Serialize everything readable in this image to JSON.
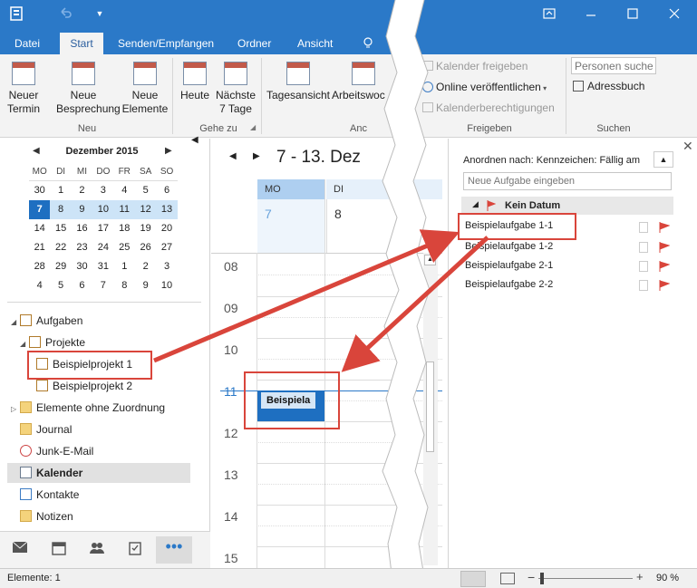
{
  "title_bar": {
    "colors": {
      "primary": "#2b79c8"
    }
  },
  "tabs": [
    "Datei",
    "Start",
    "Senden/Empfangen",
    "Ordner",
    "Ansicht"
  ],
  "ribbon": {
    "neu": {
      "new_appointment": [
        "Neuer",
        "Termin"
      ],
      "new_meeting": [
        "Neue",
        "Besprechung"
      ],
      "new_items": [
        "Neue",
        "Elemente"
      ],
      "group": "Neu"
    },
    "goto": {
      "today": "Heute",
      "next7": [
        "Nächste",
        "7 Tage"
      ],
      "group": "Gehe zu"
    },
    "arrange": {
      "day_view": "Tagesansicht",
      "work_week": "Arbeitswoc",
      "group": "Anc"
    },
    "share": {
      "share_calendar": "Kalender freigeben",
      "publish_online": "Online veröffentlichen",
      "calendar_permissions": "Kalenderberechtigungen",
      "group": "Freigeben"
    },
    "search": {
      "search_people_placeholder": "Personen suchen",
      "address_book": "Adressbuch",
      "group": "Suchen"
    }
  },
  "mini_calendar": {
    "month": "Dezember 2015",
    "weekdays": [
      "MO",
      "DI",
      "MI",
      "DO",
      "FR",
      "SA",
      "SO"
    ],
    "weeks": [
      [
        "30",
        "1",
        "2",
        "3",
        "4",
        "5",
        "6"
      ],
      [
        "7",
        "8",
        "9",
        "10",
        "11",
        "12",
        "13"
      ],
      [
        "14",
        "15",
        "16",
        "17",
        "18",
        "19",
        "20"
      ],
      [
        "21",
        "22",
        "23",
        "24",
        "25",
        "26",
        "27"
      ],
      [
        "28",
        "29",
        "30",
        "31",
        "1",
        "2",
        "3"
      ],
      [
        "4",
        "5",
        "6",
        "7",
        "8",
        "9",
        "10"
      ]
    ]
  },
  "folders": {
    "tasks": "Aufgaben",
    "projects": "Projekte",
    "project1": "Beispielprojekt 1",
    "project2": "Beispielprojekt 2",
    "unassigned": "Elemente ohne Zuordnung",
    "journal": "Journal",
    "junk": "Junk-E-Mail",
    "calendar": "Kalender",
    "contacts": "Kontakte",
    "notes": "Notizen"
  },
  "calendar": {
    "range": "7 - 13. Dez",
    "days": [
      {
        "name": "MO",
        "num": "7"
      },
      {
        "name": "DI",
        "num": "8"
      }
    ],
    "hours": [
      "08",
      "09",
      "10",
      "11",
      "12",
      "13",
      "14",
      "15"
    ],
    "appointment": "Beispiela"
  },
  "task_pane": {
    "arrange_by": "Anordnen nach: Kennzeichen: Fällig am",
    "new_task_placeholder": "Neue Aufgabe eingeben",
    "group_header": "Kein Datum",
    "tasks": [
      "Beispielaufgabe 1-1",
      "Beispielaufgabe 1-2",
      "Beispielaufgabe 2-1",
      "Beispielaufgabe 2-2"
    ]
  },
  "status_bar": {
    "items": "Elemente: 1",
    "zoom": "90 %"
  }
}
